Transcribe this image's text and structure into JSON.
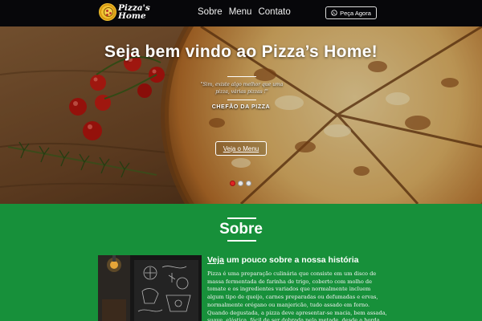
{
  "brand": {
    "name_line1": "Pizza's",
    "name_line2": "Home"
  },
  "nav": {
    "items": [
      {
        "label": "Sobre"
      },
      {
        "label": "Menu"
      },
      {
        "label": "Contato"
      }
    ],
    "order_button": "Peça Agora",
    "order_icon": "whatsapp-icon"
  },
  "hero": {
    "title": "Seja bem vindo ao Pizza’s Home!",
    "quote": "\"Sim, existe algo melhor que uma pizza, várias pizzas !\"",
    "author": "CHEFÃO DA PIZZA",
    "cta": "Veja o Menu",
    "carousel": {
      "slides": 3,
      "active_index": 0
    }
  },
  "about": {
    "title": "Sobre",
    "heading_underlined": "Veja",
    "heading_rest": " um pouco sobre a nossa história",
    "body": "Pizza é uma preparação culinária que consiste em um disco de massa fermentada de farinha de trigo, coberto com molho de tomate e os ingredientes variados que normalmente incluem algum tipo de queijo, carnes preparadas ou defumadas e ervas, normalmente orégano ou manjericão, tudo assado em forno. Quando degustada, a pizza deve apresentar-se macia, bem assada, suave, elástica, fácil de ser dobrada pela metade, desde a borda até o centro do disco. O"
  },
  "colors": {
    "navbar": "#07070a",
    "section_green": "#17903a",
    "carousel_active": "#e02424",
    "text_light": "#ffffff"
  }
}
